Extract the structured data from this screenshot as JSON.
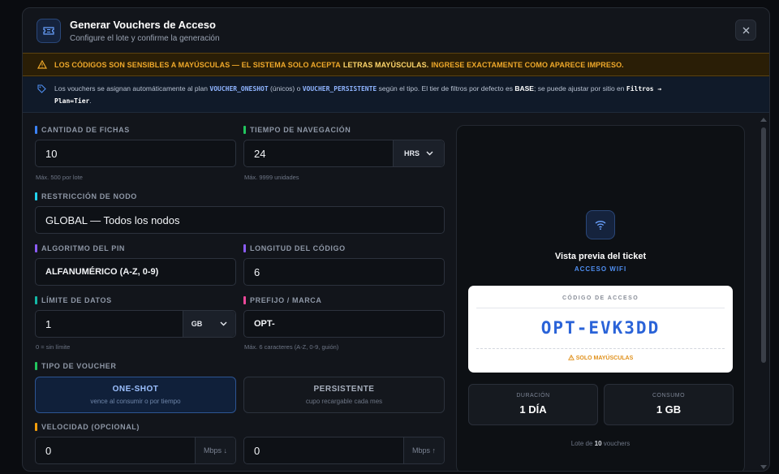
{
  "header": {
    "title": "Generar Vouchers de Acceso",
    "subtitle": "Configure el lote y confirme la generación"
  },
  "warning": {
    "part1": "LOS CÓDIGOS SON SENSIBLES A MAYÚSCULAS — EL SISTEMA SOLO ACEPTA",
    "strong": "LETRAS MAYÚSCULAS.",
    "part2": "INGRESE EXACTAMENTE COMO APARECE IMPRESO."
  },
  "info": {
    "t1": "Los vouchers se asignan automáticamente al plan",
    "code1": "VOUCHER_ONESHOT",
    "t2": "(únicos) o",
    "code2": "VOUCHER_PERSISTENTE",
    "t3": "según el tipo. El tier de filtros por defecto es",
    "tier": "BASE",
    "t4": "; se puede ajustar por sitio en",
    "code3": "Filtros →",
    "code4": "Plan=Tier",
    "t5": "."
  },
  "form": {
    "cantidad": {
      "label": "CANTIDAD DE FICHAS",
      "value": "10",
      "hint": "Máx. 500 por lote"
    },
    "tiempo": {
      "label": "TIEMPO DE NAVEGACIÓN",
      "value": "24",
      "unit": "HRS",
      "hint": "Máx. 9999 unidades"
    },
    "nodo": {
      "label": "RESTRICCIÓN DE NODO",
      "value": "GLOBAL — Todos los nodos"
    },
    "algoritmo": {
      "label": "ALGORITMO DEL PIN",
      "value": "ALFANUMÉRICO (A-Z, 0-9)"
    },
    "longitud": {
      "label": "LONGITUD DEL CÓDIGO",
      "value": "6"
    },
    "datos": {
      "label": "LÍMITE DE DATOS",
      "value": "1",
      "unit": "GB",
      "hint": "0 = sin límite"
    },
    "prefijo": {
      "label": "PREFIJO / MARCA",
      "value": "OPT-",
      "hint": "Máx. 6 caracteres (A-Z, 0-9, guión)"
    },
    "tipo": {
      "label": "TIPO DE VOUCHER",
      "oneshot": {
        "title": "ONE-SHOT",
        "desc": "vence al consumir o por tiempo"
      },
      "persistente": {
        "title": "PERSISTENTE",
        "desc": "cupo recargable cada mes"
      }
    },
    "velocidad": {
      "label": "VELOCIDAD (OPCIONAL)",
      "down": "0",
      "down_unit": "Mbps ↓",
      "up": "0",
      "up_unit": "Mbps ↑"
    }
  },
  "preview": {
    "title": "Vista previa del ticket",
    "subtitle": "ACCESO WIFI",
    "ticket_label": "CÓDIGO DE ACCESO",
    "code": "OPT-EVK3DD",
    "warn": "SOLO MAYÚSCULAS",
    "duracion_label": "DURACIÓN",
    "duracion_value": "1 DÍA",
    "consumo_label": "CONSUMO",
    "consumo_value": "1 GB",
    "footer_pre": "Lote de",
    "footer_count": "10",
    "footer_post": "vouchers"
  },
  "colors": {
    "accent": "#2a63d8",
    "warning": "#f0a92a",
    "bar_blue": "#3b82f6",
    "bar_green": "#22c55e",
    "bar_cyan": "#22d3ee",
    "bar_purple": "#8b5cf6",
    "bar_teal": "#14b8a6",
    "bar_pink": "#ec4899",
    "bar_orange": "#f59e0b"
  },
  "icons": {
    "header": "ticket-icon",
    "close": "close-icon",
    "warning": "warning-icon",
    "info": "tag-icon",
    "preview": "wifi-icon"
  }
}
